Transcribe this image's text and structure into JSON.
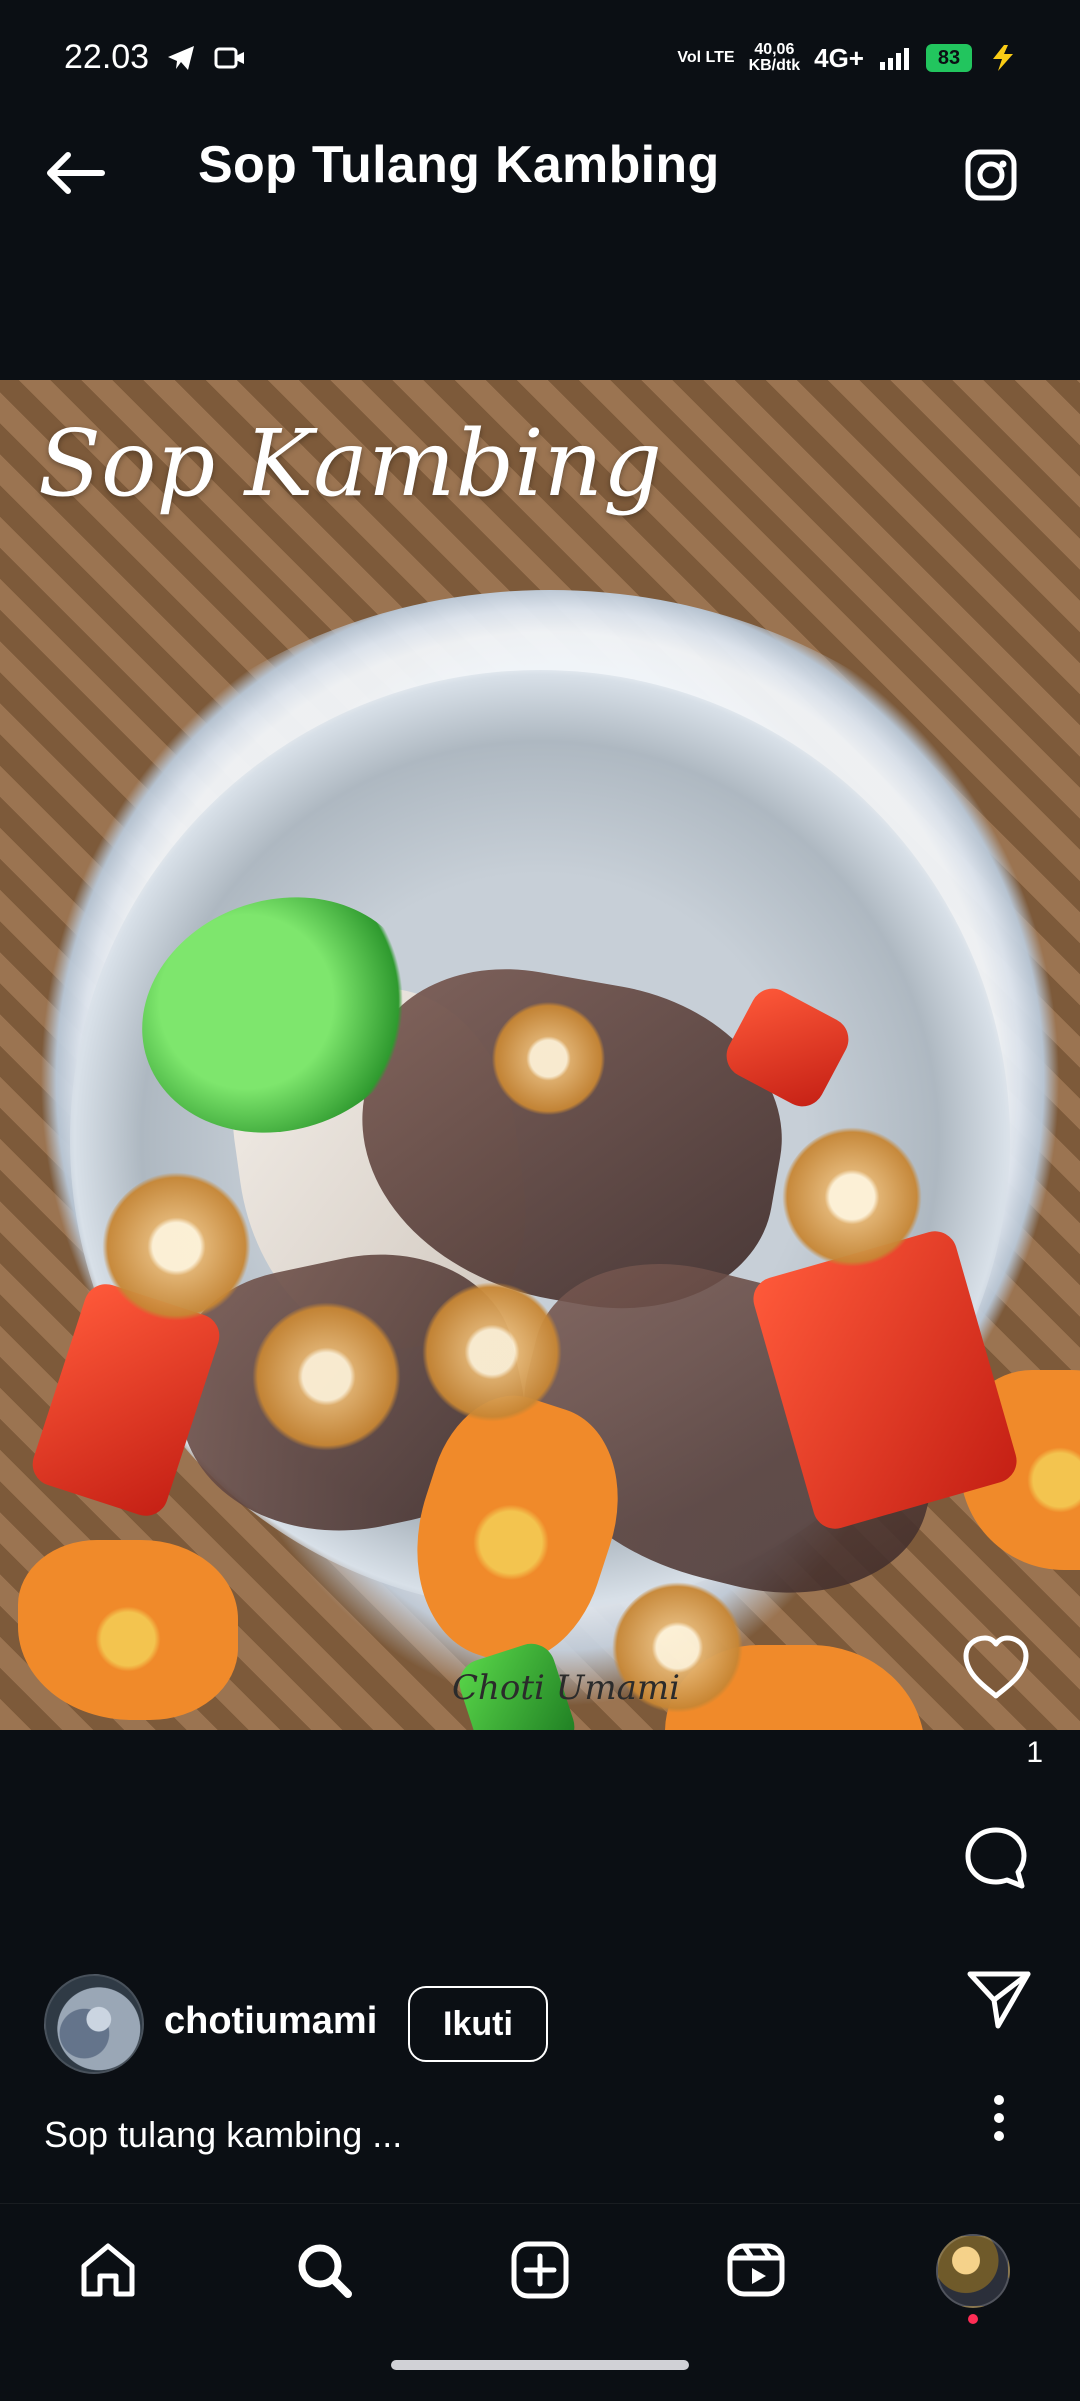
{
  "status_bar": {
    "time": "22.03",
    "lte_label": "Vol LTE",
    "speed_value": "40,06",
    "speed_unit": "KB/dtk",
    "network": "4G+",
    "battery": "83"
  },
  "header": {
    "title": "Sop Tulang Kambing"
  },
  "post": {
    "media_overlay_text": "Sop Kambing",
    "watermark": "Choti Umami",
    "like_count": "1",
    "author": {
      "username": "chotiumami",
      "follow_label": "Ikuti"
    },
    "caption": "Sop tulang kambing ..."
  }
}
